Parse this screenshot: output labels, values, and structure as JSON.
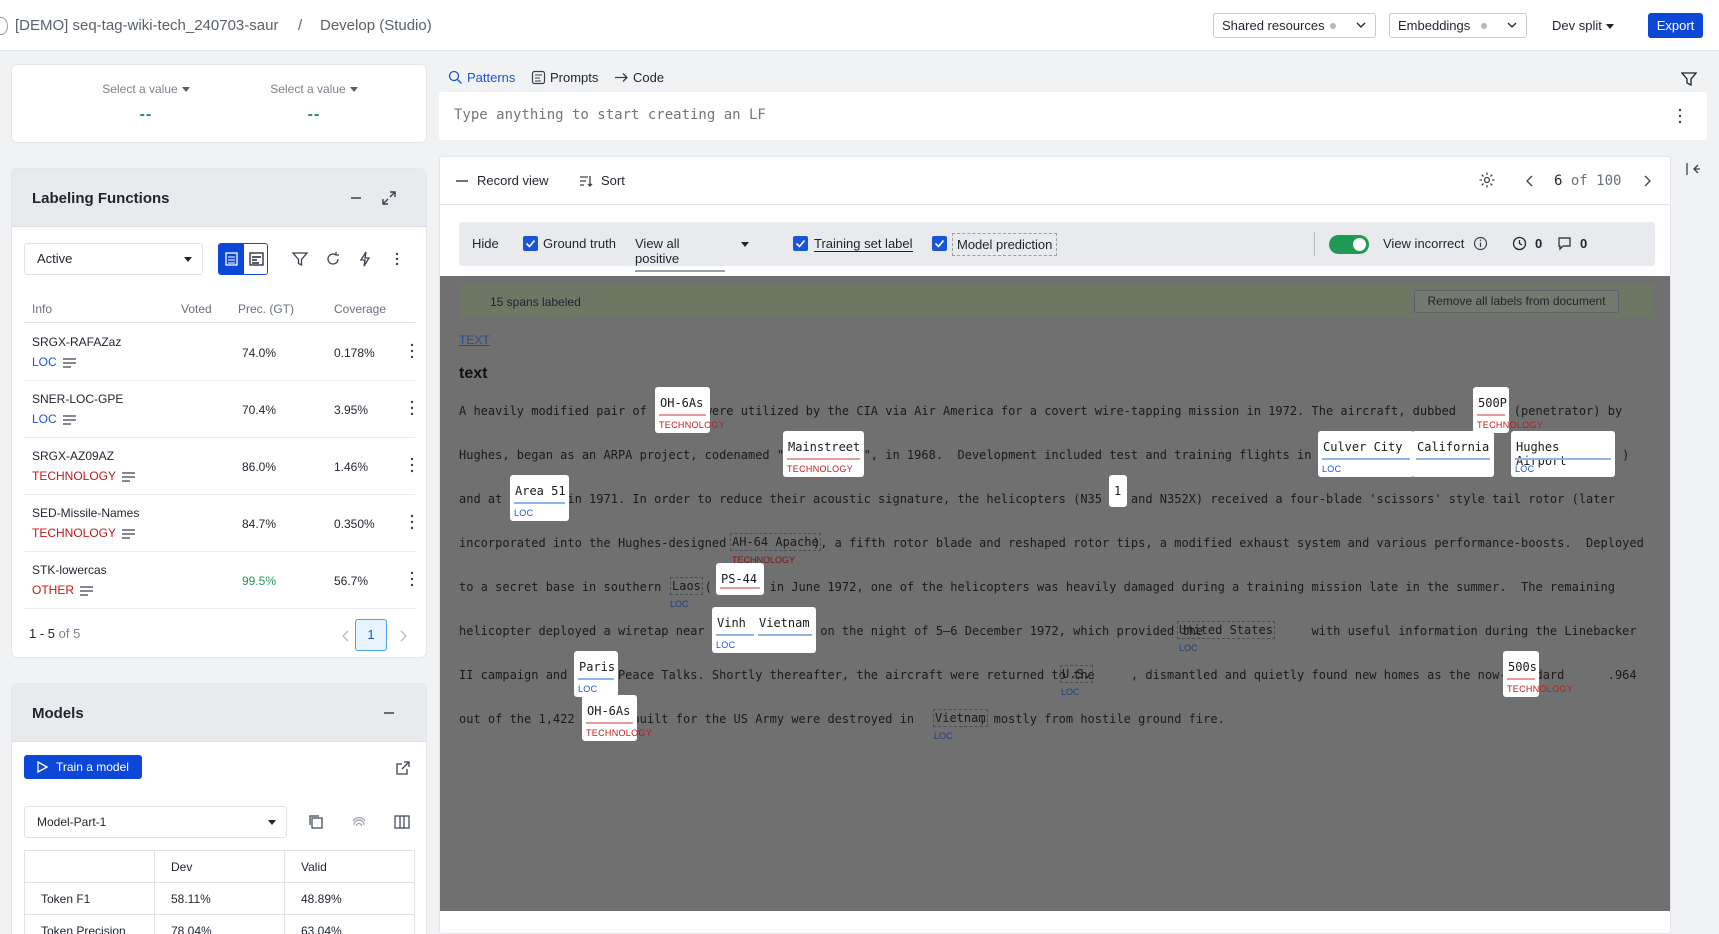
{
  "header": {
    "project": "[DEMO] seq-tag-wiki-tech_240703-saur",
    "separator": "/",
    "page": "Develop (Studio)",
    "shared_resources": "Shared resources",
    "embeddings": "Embeddings",
    "split": "Dev split",
    "export": "Export"
  },
  "selectors": [
    {
      "label": "Select a value",
      "value": "--"
    },
    {
      "label": "Select a value",
      "value": "--"
    }
  ],
  "labeling_functions": {
    "title": "Labeling Functions",
    "filter": "Active",
    "columns": [
      "Info",
      "Voted",
      "Prec. (GT)",
      "Coverage"
    ],
    "rows": [
      {
        "name": "SRGX-RAFAZaz",
        "label": "LOC",
        "precision": "74.0%",
        "coverage": "0.178%"
      },
      {
        "name": "SNER-LOC-GPE",
        "label": "LOC",
        "precision": "70.4%",
        "coverage": "3.95%"
      },
      {
        "name": "SRGX-AZ09AZ",
        "label": "TECHNOLOGY",
        "precision": "86.0%",
        "coverage": "1.46%"
      },
      {
        "name": "SED-Missile-Names",
        "label": "TECHNOLOGY",
        "precision": "84.7%",
        "coverage": "0.350%"
      },
      {
        "name": "STK-lowercas",
        "label": "OTHER",
        "precision": "99.5%",
        "coverage": "56.7%"
      }
    ],
    "pagination": {
      "range": "1 - 5",
      "of": "of 5",
      "page": "1"
    }
  },
  "models": {
    "title": "Models",
    "train_button": "Train a model",
    "selected_model": "Model-Part-1",
    "metrics_header": [
      "",
      "Dev",
      "Valid"
    ],
    "metrics": [
      [
        "Token F1",
        "58.11%",
        "48.89%"
      ],
      [
        "Token Precision",
        "78.04%",
        "63.04%"
      ]
    ]
  },
  "editor": {
    "tabs": [
      "Patterns",
      "Prompts",
      "Code"
    ],
    "placeholder": "Type anything to start creating an LF"
  },
  "record": {
    "record_view": "Record view",
    "sort": "Sort",
    "current": "6",
    "total": "of 100",
    "filters": {
      "hide": "Hide",
      "ground_truth": "Ground truth",
      "view_mode": "View all positive",
      "training_set_label": "Training set label",
      "model_prediction": "Model prediction",
      "view_incorrect": "View incorrect",
      "clock_count": "0",
      "comment_count": "0"
    },
    "spans_labeled": "15 spans labeled",
    "remove_labels": "Remove all labels from document",
    "field_link": "TEXT",
    "field_name": "text",
    "lines": [
      "A heavily modified pair of        were utilized by the CIA via Air America for a covert wire-tapping mission in 1972. The aircraft, dubbed        (penetrator) by",
      "Hughes, began as an ARPA project, codenamed \"           \", in 1968.  Development included test and training flights in             ,              (              )",
      "and at         in 1971. In order to reduce their acoustic signature, the helicopters (N35  X and N352X) received a four-blade 'scissors' style tail rotor (later",
      "incorporated into the Hughes-designed            ), a fifth rotor blade and reshaped rotor tips, a modified exhaust system and various performance-boosts.  Deployed",
      "to a secret base in southern      (      ) in June 1972, one of the helicopters was heavily damaged during a training mission late in the summer.  The remaining",
      "helicopter deployed a wiretap near     ,          on the night of 5–6 December 1972, which provided the               with useful information during the Linebacker",
      "II campaign and       Peace Talks. Shortly thereafter, the aircraft were returned to the     , dismantled and quietly found new homes as the now-standard      .964",
      "out of the 1,422        built for the US Army were destroyed in         , mostly from hostile ground fire."
    ],
    "spans": [
      {
        "word": "OH-6As",
        "tag": "TECHNOLOGY",
        "kind": "tech"
      },
      {
        "word": "500P",
        "tag": "TECHNOLOGY",
        "kind": "tech"
      },
      {
        "word": "Mainstreet",
        "tag": "TECHNOLOGY",
        "kind": "tech"
      },
      {
        "word": "Culver City",
        "tag": "LOC",
        "kind": "loc"
      },
      {
        "word": "California",
        "tag": "",
        "kind": "loc"
      },
      {
        "word": "Hughes Airport",
        "tag": "LOC",
        "kind": "loc"
      },
      {
        "word": "Area 51",
        "tag": "LOC",
        "kind": "loc"
      },
      {
        "word": "1",
        "tag": "",
        "kind": "loc"
      },
      {
        "word": "AH-64 Apache",
        "tag": "TECHNOLOGY",
        "kind": "tech"
      },
      {
        "word": "Laos",
        "tag": "LOC",
        "kind": "loc"
      },
      {
        "word": "PS-44",
        "tag": "",
        "kind": "tech"
      },
      {
        "word": "Vinh",
        "tag": "LOC",
        "kind": "loc"
      },
      {
        "word": "Vietnam",
        "tag": "",
        "kind": "loc"
      },
      {
        "word": "United States",
        "tag": "LOC",
        "kind": "loc"
      },
      {
        "word": "Paris",
        "tag": "LOC",
        "kind": "loc"
      },
      {
        "word": "U.S.",
        "tag": "LOC",
        "kind": "loc"
      },
      {
        "word": "500s",
        "tag": "TECHNOLOGY",
        "kind": "tech"
      },
      {
        "word": "OH-6As",
        "tag": "TECHNOLOGY",
        "kind": "tech"
      },
      {
        "word": "Vietnam",
        "tag": "LOC",
        "kind": "loc"
      }
    ]
  }
}
